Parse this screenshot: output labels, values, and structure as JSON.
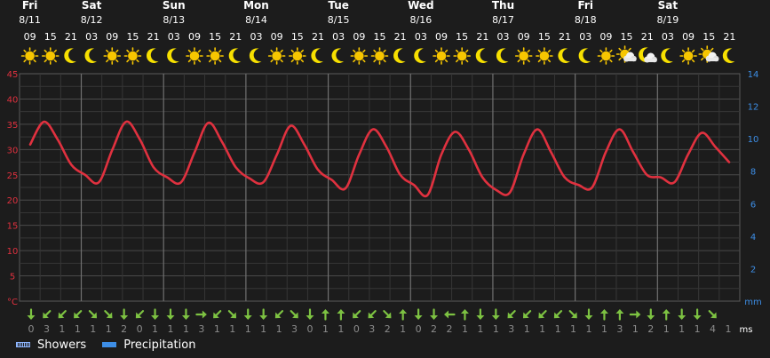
{
  "chart_data": {
    "type": "line",
    "days": [
      {
        "weekday": "Fri",
        "date": "8/11",
        "start_index": 0
      },
      {
        "weekday": "Sat",
        "date": "8/12",
        "start_index": 3
      },
      {
        "weekday": "Sun",
        "date": "8/13",
        "start_index": 7
      },
      {
        "weekday": "Mon",
        "date": "8/14",
        "start_index": 11
      },
      {
        "weekday": "Tue",
        "date": "8/15",
        "start_index": 15
      },
      {
        "weekday": "Wed",
        "date": "8/16",
        "start_index": 19
      },
      {
        "weekday": "Thu",
        "date": "8/17",
        "start_index": 23
      },
      {
        "weekday": "Fri",
        "date": "8/18",
        "start_index": 27
      },
      {
        "weekday": "Sat",
        "date": "8/19",
        "start_index": 31
      }
    ],
    "hours": [
      "09",
      "15",
      "21",
      "03",
      "09",
      "15",
      "21",
      "03",
      "09",
      "15",
      "21",
      "03",
      "09",
      "15",
      "21",
      "03",
      "09",
      "15",
      "21",
      "03",
      "09",
      "15",
      "21",
      "03",
      "09",
      "15",
      "21",
      "03",
      "09",
      "15",
      "21",
      "03",
      "09",
      "15",
      "21"
    ],
    "weather_icons": [
      "sun",
      "sun",
      "moon",
      "moon",
      "sun",
      "sun",
      "moon",
      "moon",
      "sun",
      "sun",
      "moon",
      "moon",
      "sun",
      "sun",
      "moon",
      "moon",
      "sun",
      "sun",
      "moon",
      "moon",
      "sun",
      "sun",
      "moon",
      "moon",
      "sun",
      "sun",
      "moon",
      "moon",
      "sun",
      "sun-cloud",
      "moon-cloud",
      "moon",
      "sun",
      "sun-cloud",
      "moon"
    ],
    "series": [
      {
        "values": [
          31,
          35.5,
          32,
          27,
          25,
          23.5,
          30,
          35.5,
          32,
          26.5,
          24.5,
          23.5,
          29.5,
          35.3,
          31.5,
          26.5,
          24.3,
          23.5,
          29,
          34.7,
          31,
          26,
          24,
          22.3,
          29,
          34,
          30.5,
          25,
          23,
          21,
          29,
          33.5,
          30,
          24.5,
          22,
          21.5,
          29,
          34,
          29.5,
          24.5,
          23,
          22.5,
          29.5,
          34,
          29.5,
          25,
          24.5,
          23.5,
          29,
          33.3,
          30.5,
          27.5
        ]
      }
    ],
    "temp_axis": {
      "ylim": [
        0,
        45
      ],
      "ticks": [
        0,
        5,
        10,
        15,
        20,
        25,
        30,
        35,
        40,
        45
      ],
      "tick_labels": [
        "°C",
        "5",
        "10",
        "15",
        "20",
        "25",
        "30",
        "35",
        "40",
        "45"
      ]
    },
    "precip_axis": {
      "ylim": [
        0,
        14
      ],
      "ticks": [
        0,
        2,
        4,
        6,
        8,
        10,
        12,
        14
      ],
      "tick_labels": [
        "mm",
        "2",
        "4",
        "6",
        "8",
        "10",
        "12",
        "14"
      ]
    },
    "wind": {
      "unit": "ms",
      "speeds": [
        "0",
        "3",
        "1",
        "1",
        "1",
        "1",
        "2",
        "0",
        "1",
        "1",
        "1",
        "3",
        "1",
        "1",
        "1",
        "1",
        "1",
        "3",
        "0",
        "1",
        "1",
        "0",
        "3",
        "2",
        "1",
        "0",
        "2",
        "2",
        "1",
        "1",
        "1",
        "3",
        "1",
        "1",
        "1",
        "1",
        "1",
        "1",
        "3",
        "1",
        "2",
        "1",
        "1",
        "1",
        "4",
        "1"
      ],
      "directions": [
        0,
        45,
        45,
        45,
        315,
        315,
        0,
        45,
        0,
        0,
        0,
        270,
        45,
        315,
        0,
        0,
        45,
        315,
        0,
        180,
        180,
        45,
        45,
        315,
        180,
        0,
        0,
        90,
        180,
        0,
        0,
        45,
        45,
        45,
        45,
        315,
        0,
        180,
        180,
        270,
        0,
        180,
        0,
        0,
        315
      ]
    },
    "grid": true,
    "legend": [
      {
        "name": "Showers",
        "color": "#8eb6ff",
        "style": "hatched"
      },
      {
        "name": "Precipitation",
        "color": "#3d8ee6",
        "style": "solid"
      }
    ],
    "colors": {
      "temperature": "#e0313f",
      "left_axis": "#e0313f",
      "right_axis": "#3d8ee6",
      "wind_arrow": "#7dc242",
      "wind_speed": "#8c8c8c",
      "sun": "#f7c600",
      "moon": "#f7e000"
    }
  }
}
